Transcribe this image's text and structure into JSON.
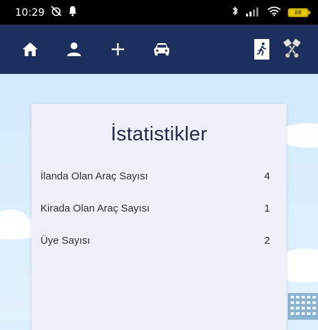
{
  "status_bar": {
    "time": "10:29",
    "battery": "88"
  },
  "nav": {
    "items": [
      {
        "icon": "home-icon"
      },
      {
        "icon": "person-icon"
      },
      {
        "icon": "plus-icon"
      },
      {
        "icon": "car-icon"
      },
      {
        "icon": "exit-icon"
      },
      {
        "icon": "pistons-icon"
      }
    ]
  },
  "card": {
    "title": "İstatistikler",
    "rows": [
      {
        "label": "İlanda Olan Araç Sayısı",
        "value": "4"
      },
      {
        "label": "Kirada Olan Araç Sayısı",
        "value": "1"
      },
      {
        "label": "Üye Sayısı",
        "value": "2"
      }
    ]
  },
  "colors": {
    "navbar": "#1d2f5f",
    "card": "#eef0f8",
    "background": "#dceefb"
  }
}
